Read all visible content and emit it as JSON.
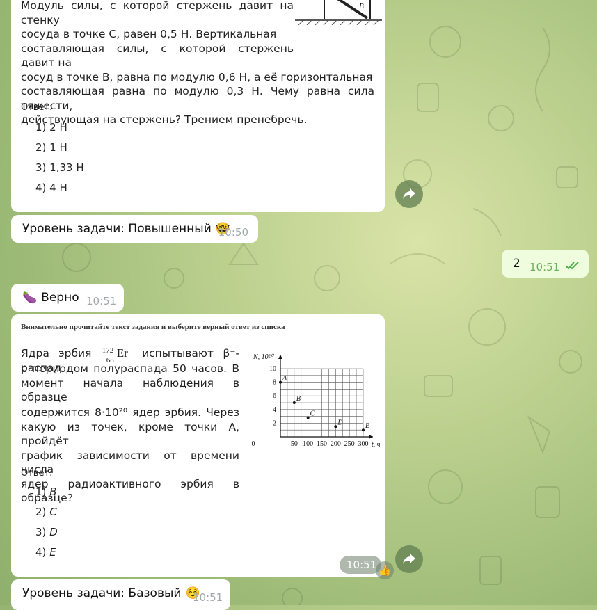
{
  "colors": {
    "outgoing_bubble": "#effdde",
    "check": "#4fae4e",
    "forward_btn": "#6a8a55"
  },
  "msg1": {
    "text_lines": [
      "Модуль силы, с которой стержень давит на стенку",
      "сосуда в точке C, равен 0,5 Н. Вертикальная",
      "составляющая силы, с которой стержень давит на",
      "сосуд в точке B, равна по модулю 0,6 Н, а её горизонтальная",
      "составляющая равна по модулю 0,3 Н. Чему равна сила тяжести,",
      "действующая на стержень? Трением пренебречь."
    ],
    "figure_label": "B",
    "answer_label": "Ответ:",
    "options": [
      "1) 2 Н",
      "2) 1 Н",
      "3) 1,33 Н",
      "4) 4 Н"
    ]
  },
  "level1": {
    "text": "Уровень задачи: Повышенный",
    "emoji": "🤓",
    "time": "10:50"
  },
  "outgoing": {
    "text": "2",
    "time": "10:51",
    "status_icon": "double-check-icon"
  },
  "verdict": {
    "emoji": "🍆",
    "text": "Верно",
    "time": "10:51"
  },
  "msg2": {
    "header": "Внимательно прочитайте текст задания и выберите верный ответ из списка",
    "intro": "Ядра эрбия",
    "isotope": {
      "mass": "172",
      "z": "68",
      "symbol": "Er"
    },
    "rest_line1": "испытывают β⁻-распад",
    "lines": [
      "с периодом полураспада 50 часов. В",
      "момент начала наблюдения в образце",
      "содержится 8·10²⁰ ядер эрбия. Через",
      "какую из точек, кроме точки A, пройдёт",
      "график зависимости от времени числа",
      "ядер радиоактивного эрбия в образце?"
    ],
    "answer_label": "Ответ:",
    "options": [
      {
        "num": "1)",
        "val": "B"
      },
      {
        "num": "2)",
        "val": "C"
      },
      {
        "num": "3)",
        "val": "D"
      },
      {
        "num": "4)",
        "val": "E"
      }
    ],
    "time": "10:51",
    "reaction": "👍"
  },
  "chart_data": {
    "type": "scatter",
    "xlabel": "t, ч",
    "ylabel": "N, 10²⁰",
    "x_ticks": [
      "50",
      "100",
      "150",
      "200",
      "250",
      "300"
    ],
    "y_ticks": [
      "2",
      "4",
      "6",
      "8",
      "10"
    ],
    "origin_label": "0",
    "xlim": [
      0,
      300
    ],
    "ylim": [
      0,
      10
    ],
    "points": [
      {
        "label": "A",
        "x": 0,
        "y": 8
      },
      {
        "label": "B",
        "x": 50,
        "y": 5
      },
      {
        "label": "C",
        "x": 100,
        "y": 2.8
      },
      {
        "label": "D",
        "x": 200,
        "y": 1.5
      },
      {
        "label": "E",
        "x": 300,
        "y": 1
      }
    ]
  },
  "level2": {
    "text": "Уровень задачи: Базовый",
    "emoji": "☺️",
    "time": "10:51"
  }
}
